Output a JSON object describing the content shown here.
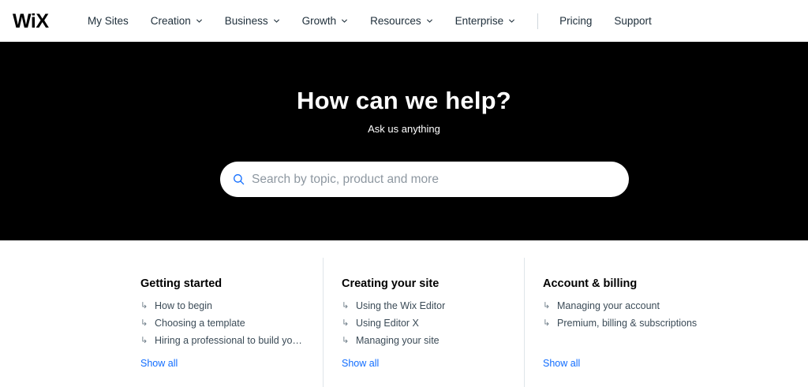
{
  "brand": {
    "logo_text": "WiX"
  },
  "nav": {
    "items": [
      {
        "label": "My Sites",
        "has_dropdown": false
      },
      {
        "label": "Creation",
        "has_dropdown": true
      },
      {
        "label": "Business",
        "has_dropdown": true
      },
      {
        "label": "Growth",
        "has_dropdown": true
      },
      {
        "label": "Resources",
        "has_dropdown": true
      },
      {
        "label": "Enterprise",
        "has_dropdown": true
      }
    ],
    "secondary": [
      {
        "label": "Pricing"
      },
      {
        "label": "Support"
      }
    ]
  },
  "hero": {
    "title": "How can we help?",
    "subtitle": "Ask us anything",
    "search_placeholder": "Search by topic, product and more",
    "search_value": ""
  },
  "categories": [
    {
      "title": "Getting started",
      "links": [
        "How to begin",
        "Choosing a template",
        "Hiring a professional to build yo…"
      ],
      "show_all": "Show all"
    },
    {
      "title": "Creating your site",
      "links": [
        "Using the Wix Editor",
        "Using Editor X",
        "Managing your site"
      ],
      "show_all": "Show all"
    },
    {
      "title": "Account & billing",
      "links": [
        "Managing your account",
        "Premium, billing & subscriptions"
      ],
      "show_all": "Show all"
    }
  ],
  "colors": {
    "hero_bg": "#000000",
    "link_blue": "#116dff",
    "text_dark": "#20303c"
  },
  "icons": {
    "dropdown": "chevron-down-icon",
    "search": "search-icon",
    "link_arrow": "arrow-return-icon"
  }
}
